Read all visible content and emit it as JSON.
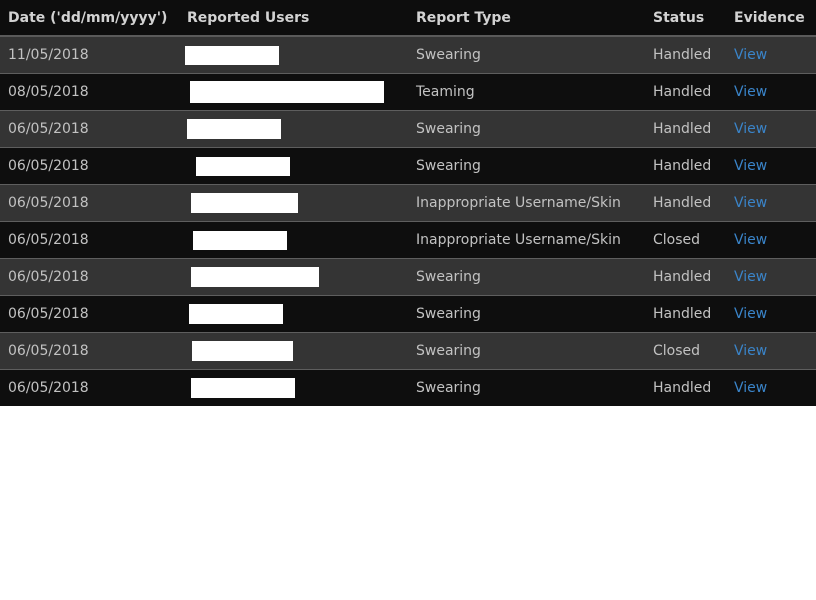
{
  "table": {
    "headers": {
      "date": "Date ('dd/mm/yyyy')",
      "reported_users": "Reported Users",
      "report_type": "Report Type",
      "status": "Status",
      "evidence": "Evidence"
    },
    "rows": [
      {
        "date": "11/05/2018",
        "reported_user": "",
        "report_type": "Swearing",
        "status": "Handled",
        "evidence": "View"
      },
      {
        "date": "08/05/2018",
        "reported_user": "",
        "report_type": "Teaming",
        "status": "Handled",
        "evidence": "View"
      },
      {
        "date": "06/05/2018",
        "reported_user": "",
        "report_type": "Swearing",
        "status": "Handled",
        "evidence": "View"
      },
      {
        "date": "06/05/2018",
        "reported_user": "",
        "report_type": "Swearing",
        "status": "Handled",
        "evidence": "View"
      },
      {
        "date": "06/05/2018",
        "reported_user": "",
        "report_type": "Inappropriate Username/Skin",
        "status": "Handled",
        "evidence": "View"
      },
      {
        "date": "06/05/2018",
        "reported_user": "",
        "report_type": "Inappropriate Username/Skin",
        "status": "Closed",
        "evidence": "View"
      },
      {
        "date": "06/05/2018",
        "reported_user": "",
        "report_type": "Swearing",
        "status": "Handled",
        "evidence": "View"
      },
      {
        "date": "06/05/2018",
        "reported_user": "",
        "report_type": "Swearing",
        "status": "Handled",
        "evidence": "View"
      },
      {
        "date": "06/05/2018",
        "reported_user": "",
        "report_type": "Swearing",
        "status": "Closed",
        "evidence": "View"
      },
      {
        "date": "06/05/2018",
        "reported_user": "",
        "report_type": "Swearing",
        "status": "Handled",
        "evidence": "View"
      }
    ]
  },
  "colors": {
    "handled": "#1db21d",
    "closed": "#ff1a1a",
    "link": "#3a84c9"
  }
}
